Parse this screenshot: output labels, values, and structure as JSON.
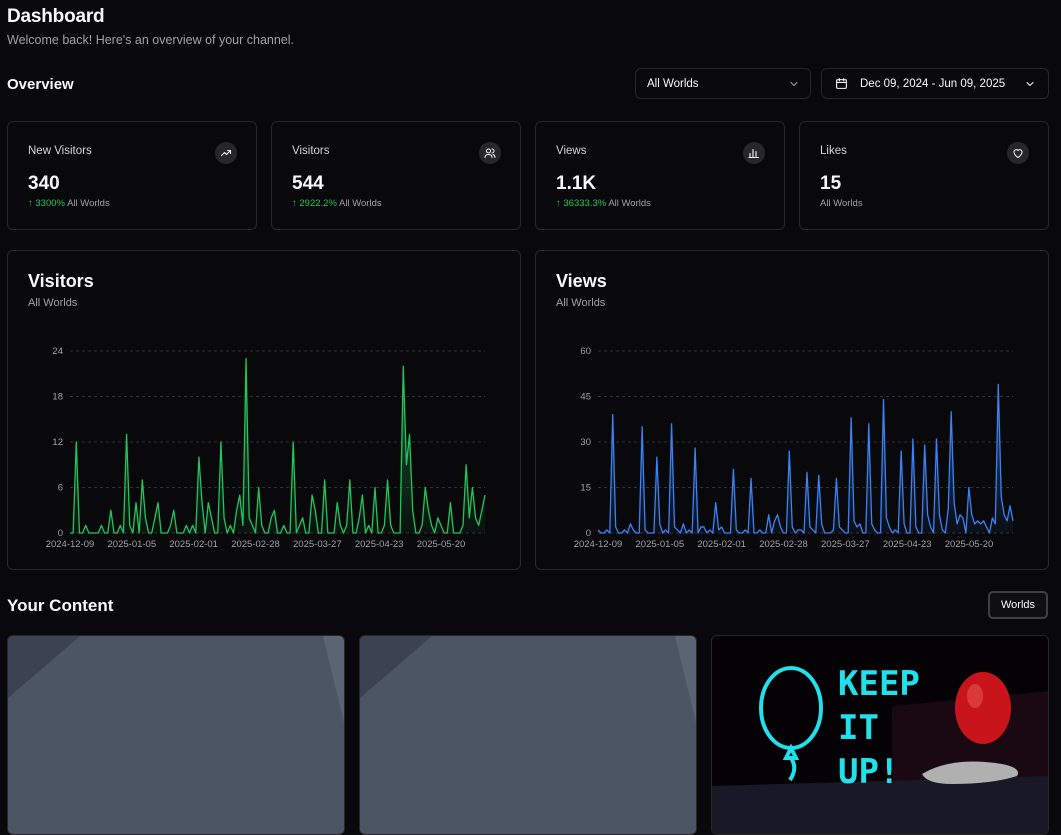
{
  "header": {
    "title": "Dashboard",
    "subtitle": "Welcome back! Here's an overview of your channel."
  },
  "overview": {
    "title": "Overview",
    "world_select": "All Worlds",
    "date_range": "Dec 09, 2024 - Jun 09, 2025"
  },
  "stats": [
    {
      "label": "New Visitors",
      "value": "340",
      "change": "↑ 3300%",
      "scope": "All Worlds",
      "icon": "trending-up-icon"
    },
    {
      "label": "Visitors",
      "value": "544",
      "change": "↑ 2922.2%",
      "scope": "All Worlds",
      "icon": "users-icon"
    },
    {
      "label": "Views",
      "value": "1.1K",
      "change": "↑ 36333.3%",
      "scope": "All Worlds",
      "icon": "bar-chart-icon"
    },
    {
      "label": "Likes",
      "value": "15",
      "change": "",
      "scope": "All Worlds",
      "icon": "heart-icon"
    }
  ],
  "colors": {
    "visitors_line": "#22c55e",
    "views_line": "#3b82f6",
    "positive": "#22c55e",
    "card_border": "#27272a"
  },
  "charts": [
    {
      "title": "Visitors",
      "subtitle": "All Worlds"
    },
    {
      "title": "Views",
      "subtitle": "All Worlds"
    }
  ],
  "chart_data": [
    {
      "type": "area",
      "title": "Visitors",
      "subtitle": "All Worlds",
      "x_ticks": [
        "2024-12-09",
        "2025-01-05",
        "2025-02-01",
        "2025-02-28",
        "2025-03-27",
        "2025-04-23",
        "2025-05-20"
      ],
      "y_ticks": [
        0,
        6,
        12,
        18,
        24
      ],
      "ylim": [
        0,
        24
      ],
      "grid": true,
      "series": [
        {
          "values": [
            0,
            0,
            12,
            0,
            0,
            1,
            0,
            0,
            0,
            0,
            1,
            0,
            0,
            3,
            0,
            0,
            1,
            0,
            13,
            1,
            0,
            4,
            0,
            7,
            2,
            0,
            0,
            2,
            4,
            0,
            0,
            0,
            1,
            3,
            0,
            0,
            0,
            1,
            0,
            1,
            0,
            10,
            4,
            0,
            4,
            2,
            0,
            0,
            12,
            2,
            0,
            1,
            0,
            3,
            5,
            1,
            23,
            2,
            1,
            0,
            6,
            1,
            0,
            0,
            2,
            3,
            0,
            0,
            1,
            0,
            0,
            12,
            0,
            1,
            2,
            0,
            0,
            5,
            3,
            0,
            0,
            7,
            0,
            0,
            0,
            4,
            1,
            0,
            1,
            7,
            0,
            0,
            2,
            5,
            0,
            1,
            0,
            6,
            0,
            0,
            1,
            7,
            1,
            0,
            0,
            0,
            22,
            9,
            13,
            3,
            0,
            0,
            1,
            6,
            3,
            1,
            0,
            2,
            1,
            0,
            0,
            4,
            0,
            0,
            0,
            1,
            9,
            2,
            6,
            2,
            1,
            3,
            5
          ]
        }
      ]
    },
    {
      "type": "area",
      "title": "Views",
      "subtitle": "All Worlds",
      "x_ticks": [
        "2024-12-09",
        "2025-01-05",
        "2025-02-01",
        "2025-02-28",
        "2025-03-27",
        "2025-04-23",
        "2025-05-20"
      ],
      "y_ticks": [
        0,
        15,
        30,
        45,
        60
      ],
      "ylim": [
        0,
        60
      ],
      "grid": true,
      "series": [
        {
          "values": [
            1,
            0,
            0,
            1,
            0,
            39,
            2,
            0,
            0,
            1,
            0,
            3,
            1,
            0,
            0,
            35,
            1,
            0,
            0,
            0,
            25,
            3,
            0,
            1,
            0,
            36,
            2,
            1,
            0,
            3,
            0,
            1,
            0,
            28,
            0,
            2,
            2,
            0,
            1,
            0,
            10,
            1,
            2,
            0,
            0,
            0,
            21,
            1,
            0,
            0,
            1,
            0,
            18,
            0,
            0,
            1,
            0,
            0,
            6,
            0,
            4,
            6,
            2,
            0,
            0,
            27,
            2,
            0,
            1,
            1,
            0,
            20,
            2,
            1,
            0,
            19,
            3,
            0,
            0,
            0,
            1,
            18,
            2,
            1,
            0,
            0,
            38,
            4,
            2,
            3,
            0,
            0,
            36,
            3,
            1,
            0,
            0,
            44,
            5,
            2,
            0,
            1,
            0,
            27,
            3,
            0,
            0,
            31,
            2,
            0,
            0,
            29,
            6,
            2,
            0,
            31,
            6,
            1,
            0,
            8,
            40,
            10,
            3,
            6,
            5,
            0,
            15,
            6,
            3,
            4,
            3,
            4,
            2,
            0,
            5,
            3,
            49,
            12,
            6,
            4,
            9,
            4
          ]
        }
      ]
    }
  ],
  "content": {
    "title": "Your Content",
    "filter_button": "Worlds",
    "thumbnail3_text": [
      "KEEP",
      "IT",
      "UP!"
    ]
  }
}
